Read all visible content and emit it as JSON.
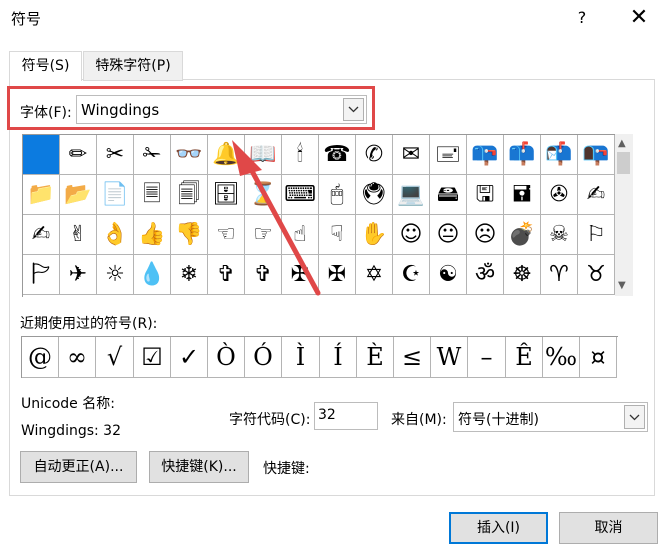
{
  "window": {
    "title": "符号",
    "help": "?",
    "close": "✕"
  },
  "tabs": [
    {
      "label": "符号(S)"
    },
    {
      "label": "特殊字符(P)"
    }
  ],
  "font": {
    "label": "字体(F):",
    "value": "Wingdings"
  },
  "grid": {
    "rows": [
      [
        "",
        "✏",
        "✂",
        "✁",
        "👓",
        "🔔",
        "📖",
        "🕯",
        "☎",
        "✆",
        "✉",
        "🖃",
        "📪",
        "📫",
        "📬",
        "📭"
      ],
      [
        "📁",
        "📂",
        "📄",
        "🗏",
        "🗐",
        "🗄",
        "⌛",
        "⌨",
        "🖱",
        "🖲",
        "💻",
        "🖴",
        "🖫",
        "🖬",
        "✇",
        "✍"
      ],
      [
        "✍",
        "✌",
        "👌",
        "👍",
        "👎",
        "☜",
        "☞",
        "☝",
        "☟",
        "✋",
        "☺",
        "😐",
        "☹",
        "💣",
        "☠",
        "⚐"
      ],
      [
        "🏱",
        "✈",
        "☼",
        "💧",
        "❄",
        "✞",
        "✞",
        "✠",
        "✠",
        "✡",
        "☪",
        "☯",
        "ॐ",
        "☸",
        "♈",
        "♉"
      ]
    ]
  },
  "recent": {
    "label": "近期使用过的符号(R):",
    "symbols": [
      "@",
      "∞",
      "√",
      "☑",
      "✓",
      "Ò",
      "Ó",
      "Ì",
      "Í",
      "È",
      "≤",
      "W",
      "–",
      "Ê",
      "‰",
      "¤"
    ]
  },
  "unicode": {
    "name_label": "Unicode 名称:",
    "name_value": "Wingdings: 32"
  },
  "charcode": {
    "label": "字符代码(C):",
    "value": "32"
  },
  "from": {
    "label": "来自(M):",
    "value": "符号(十进制)"
  },
  "buttons": {
    "autocorrect": "自动更正(A)...",
    "shortcut_key": "快捷键(K)...",
    "shortcut_label": "快捷键:",
    "insert": "插入(I)",
    "cancel": "取消"
  },
  "colors": {
    "selection": "#0c7be0",
    "highlight_box": "#e04848",
    "arrow": "#e04848"
  }
}
